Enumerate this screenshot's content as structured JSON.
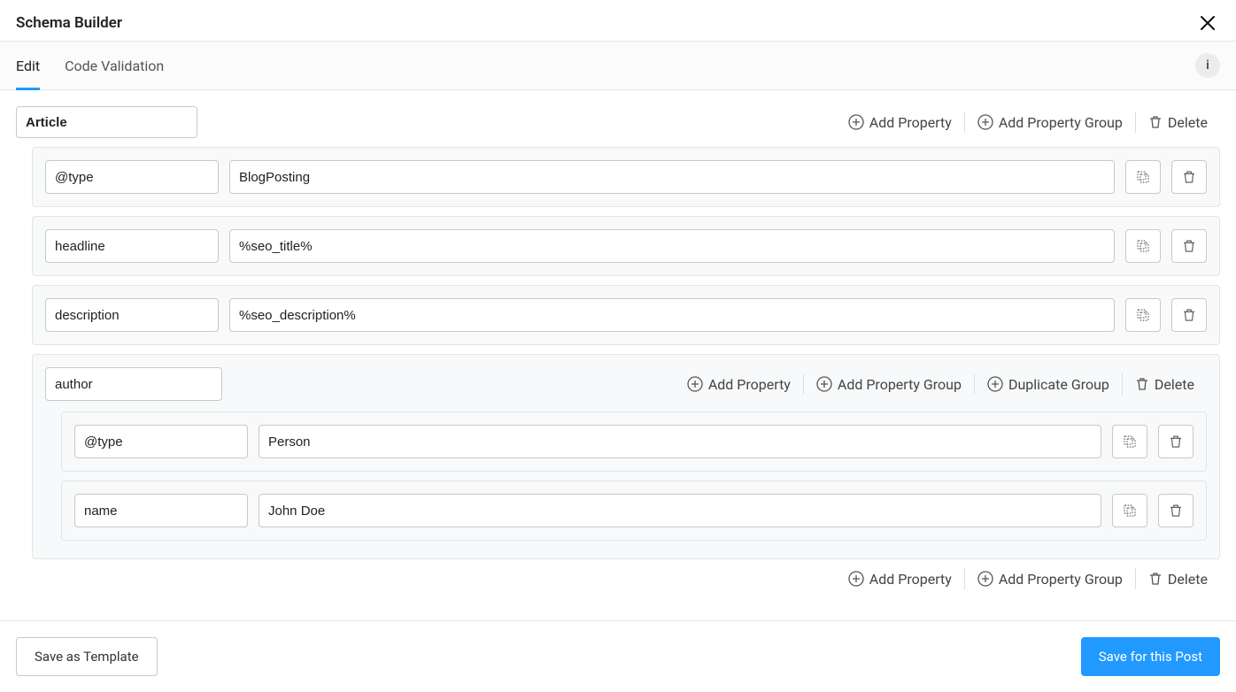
{
  "header": {
    "title": "Schema Builder"
  },
  "tabs": {
    "edit": "Edit",
    "code_validation": "Code Validation",
    "active": "edit"
  },
  "icons": {
    "info": "i"
  },
  "top_actions": {
    "add_property": "Add Property",
    "add_property_group": "Add Property Group",
    "delete": "Delete"
  },
  "schema": {
    "type_value": "Article",
    "rows": [
      {
        "key": "@type",
        "value": "BlogPosting"
      },
      {
        "key": "headline",
        "value": "%seo_title%"
      },
      {
        "key": "description",
        "value": "%seo_description%"
      }
    ],
    "group": {
      "key": "author",
      "actions": {
        "add_property": "Add Property",
        "add_property_group": "Add Property Group",
        "duplicate_group": "Duplicate Group",
        "delete": "Delete"
      },
      "rows": [
        {
          "key": "@type",
          "value": "Person"
        },
        {
          "key": "name",
          "value": "John Doe"
        }
      ]
    }
  },
  "bottom_actions": {
    "add_property": "Add Property",
    "add_property_group": "Add Property Group",
    "delete": "Delete"
  },
  "footer": {
    "save_template": "Save as Template",
    "save_post": "Save for this Post"
  }
}
